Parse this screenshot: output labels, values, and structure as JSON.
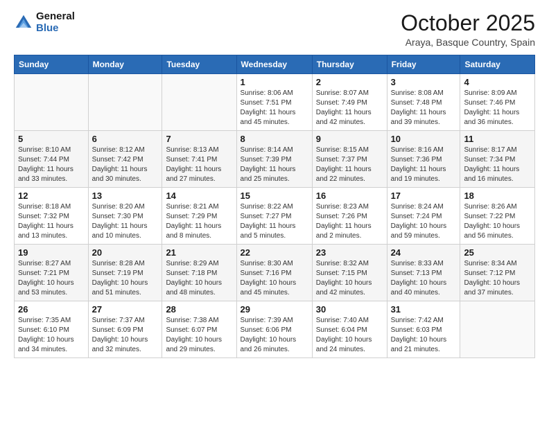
{
  "header": {
    "logo": {
      "general": "General",
      "blue": "Blue"
    },
    "title": "October 2025",
    "location": "Araya, Basque Country, Spain"
  },
  "weekdays": [
    "Sunday",
    "Monday",
    "Tuesday",
    "Wednesday",
    "Thursday",
    "Friday",
    "Saturday"
  ],
  "weeks": [
    [
      {
        "day": "",
        "info": ""
      },
      {
        "day": "",
        "info": ""
      },
      {
        "day": "",
        "info": ""
      },
      {
        "day": "1",
        "info": "Sunrise: 8:06 AM\nSunset: 7:51 PM\nDaylight: 11 hours and 45 minutes."
      },
      {
        "day": "2",
        "info": "Sunrise: 8:07 AM\nSunset: 7:49 PM\nDaylight: 11 hours and 42 minutes."
      },
      {
        "day": "3",
        "info": "Sunrise: 8:08 AM\nSunset: 7:48 PM\nDaylight: 11 hours and 39 minutes."
      },
      {
        "day": "4",
        "info": "Sunrise: 8:09 AM\nSunset: 7:46 PM\nDaylight: 11 hours and 36 minutes."
      }
    ],
    [
      {
        "day": "5",
        "info": "Sunrise: 8:10 AM\nSunset: 7:44 PM\nDaylight: 11 hours and 33 minutes."
      },
      {
        "day": "6",
        "info": "Sunrise: 8:12 AM\nSunset: 7:42 PM\nDaylight: 11 hours and 30 minutes."
      },
      {
        "day": "7",
        "info": "Sunrise: 8:13 AM\nSunset: 7:41 PM\nDaylight: 11 hours and 27 minutes."
      },
      {
        "day": "8",
        "info": "Sunrise: 8:14 AM\nSunset: 7:39 PM\nDaylight: 11 hours and 25 minutes."
      },
      {
        "day": "9",
        "info": "Sunrise: 8:15 AM\nSunset: 7:37 PM\nDaylight: 11 hours and 22 minutes."
      },
      {
        "day": "10",
        "info": "Sunrise: 8:16 AM\nSunset: 7:36 PM\nDaylight: 11 hours and 19 minutes."
      },
      {
        "day": "11",
        "info": "Sunrise: 8:17 AM\nSunset: 7:34 PM\nDaylight: 11 hours and 16 minutes."
      }
    ],
    [
      {
        "day": "12",
        "info": "Sunrise: 8:18 AM\nSunset: 7:32 PM\nDaylight: 11 hours and 13 minutes."
      },
      {
        "day": "13",
        "info": "Sunrise: 8:20 AM\nSunset: 7:30 PM\nDaylight: 11 hours and 10 minutes."
      },
      {
        "day": "14",
        "info": "Sunrise: 8:21 AM\nSunset: 7:29 PM\nDaylight: 11 hours and 8 minutes."
      },
      {
        "day": "15",
        "info": "Sunrise: 8:22 AM\nSunset: 7:27 PM\nDaylight: 11 hours and 5 minutes."
      },
      {
        "day": "16",
        "info": "Sunrise: 8:23 AM\nSunset: 7:26 PM\nDaylight: 11 hours and 2 minutes."
      },
      {
        "day": "17",
        "info": "Sunrise: 8:24 AM\nSunset: 7:24 PM\nDaylight: 10 hours and 59 minutes."
      },
      {
        "day": "18",
        "info": "Sunrise: 8:26 AM\nSunset: 7:22 PM\nDaylight: 10 hours and 56 minutes."
      }
    ],
    [
      {
        "day": "19",
        "info": "Sunrise: 8:27 AM\nSunset: 7:21 PM\nDaylight: 10 hours and 53 minutes."
      },
      {
        "day": "20",
        "info": "Sunrise: 8:28 AM\nSunset: 7:19 PM\nDaylight: 10 hours and 51 minutes."
      },
      {
        "day": "21",
        "info": "Sunrise: 8:29 AM\nSunset: 7:18 PM\nDaylight: 10 hours and 48 minutes."
      },
      {
        "day": "22",
        "info": "Sunrise: 8:30 AM\nSunset: 7:16 PM\nDaylight: 10 hours and 45 minutes."
      },
      {
        "day": "23",
        "info": "Sunrise: 8:32 AM\nSunset: 7:15 PM\nDaylight: 10 hours and 42 minutes."
      },
      {
        "day": "24",
        "info": "Sunrise: 8:33 AM\nSunset: 7:13 PM\nDaylight: 10 hours and 40 minutes."
      },
      {
        "day": "25",
        "info": "Sunrise: 8:34 AM\nSunset: 7:12 PM\nDaylight: 10 hours and 37 minutes."
      }
    ],
    [
      {
        "day": "26",
        "info": "Sunrise: 7:35 AM\nSunset: 6:10 PM\nDaylight: 10 hours and 34 minutes."
      },
      {
        "day": "27",
        "info": "Sunrise: 7:37 AM\nSunset: 6:09 PM\nDaylight: 10 hours and 32 minutes."
      },
      {
        "day": "28",
        "info": "Sunrise: 7:38 AM\nSunset: 6:07 PM\nDaylight: 10 hours and 29 minutes."
      },
      {
        "day": "29",
        "info": "Sunrise: 7:39 AM\nSunset: 6:06 PM\nDaylight: 10 hours and 26 minutes."
      },
      {
        "day": "30",
        "info": "Sunrise: 7:40 AM\nSunset: 6:04 PM\nDaylight: 10 hours and 24 minutes."
      },
      {
        "day": "31",
        "info": "Sunrise: 7:42 AM\nSunset: 6:03 PM\nDaylight: 10 hours and 21 minutes."
      },
      {
        "day": "",
        "info": ""
      }
    ]
  ]
}
